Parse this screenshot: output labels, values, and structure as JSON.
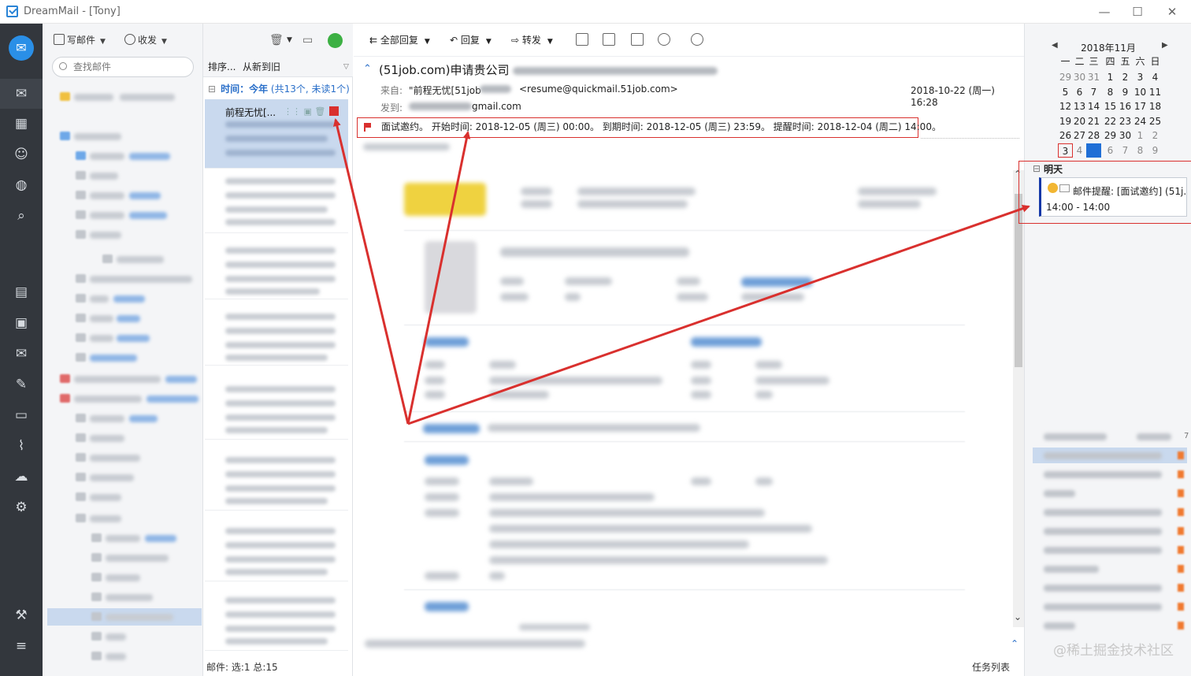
{
  "window": {
    "title": "DreamMail - [Tony]",
    "minimize": "—",
    "maximize": "☐",
    "close": "✕"
  },
  "nav": {
    "brand_icon": "envelope-icon",
    "items": [
      "mail-icon",
      "calendar-icon",
      "contacts-icon",
      "globe-icon",
      "search-icon",
      "board-icon",
      "account-icon",
      "inbox-icon",
      "compose-icon",
      "notes-icon",
      "attachment-icon",
      "cloud-icon",
      "settings-icon",
      "tools-icon",
      "menu-icon"
    ]
  },
  "folder_pane": {
    "compose_label": "写邮件",
    "receive_label": "收发",
    "search_placeholder": "查找邮件"
  },
  "list_pane": {
    "sort_label": "排序...",
    "sort_order": "从新到旧",
    "group_label": "时间：今年",
    "group_count": "(共13个, 未读1个)",
    "first_sender": "前程无忧[..."
  },
  "read_toolbar": {
    "reply_all": "全部回复",
    "reply": "回复",
    "forward": "转发"
  },
  "message": {
    "subject": "(51job.com)申请贵公司",
    "from_label": "来自:",
    "from_name": "\"前程无忧[51job",
    "from_email": "<resume@quickmail.51job.com>",
    "date": "2018-10-22 (周一) 16:28",
    "to_label": "发到:",
    "to_value": "gmail.com"
  },
  "notice": {
    "text": "面试邀约。   开始时间: 2018-12-05 (周三) 00:00。   到期时间: 2018-12-05 (周三) 23:59。   提醒时间: 2018-12-04 (周二) 14:00。"
  },
  "calendar": {
    "month_label": "2018年11月",
    "weekdays": [
      "一",
      "二",
      "三",
      "四",
      "五",
      "六",
      "日"
    ],
    "weeks": [
      [
        "29",
        "30",
        "31",
        "1",
        "2",
        "3",
        "4"
      ],
      [
        "5",
        "6",
        "7",
        "8",
        "9",
        "10",
        "11"
      ],
      [
        "12",
        "13",
        "14",
        "15",
        "16",
        "17",
        "18"
      ],
      [
        "19",
        "20",
        "21",
        "22",
        "23",
        "24",
        "25"
      ],
      [
        "26",
        "27",
        "28",
        "29",
        "30",
        "1",
        "2"
      ],
      [
        "3",
        "4",
        "",
        "6",
        "7",
        "8",
        "9"
      ]
    ]
  },
  "agenda": {
    "header": "明天",
    "reminder_title": "邮件提醒: [面试邀约] (51j...",
    "reminder_time": "14:00 - 14:00",
    "count_badge": "7"
  },
  "status": {
    "mail_count": "邮件: 选:1 总:15",
    "task_list": "任务列表",
    "watermark": "@稀土掘金技术社区"
  },
  "colors": {
    "accent": "#2a8fe7",
    "annotation_red": "#d9302e",
    "selection": "#c9d9ee"
  }
}
